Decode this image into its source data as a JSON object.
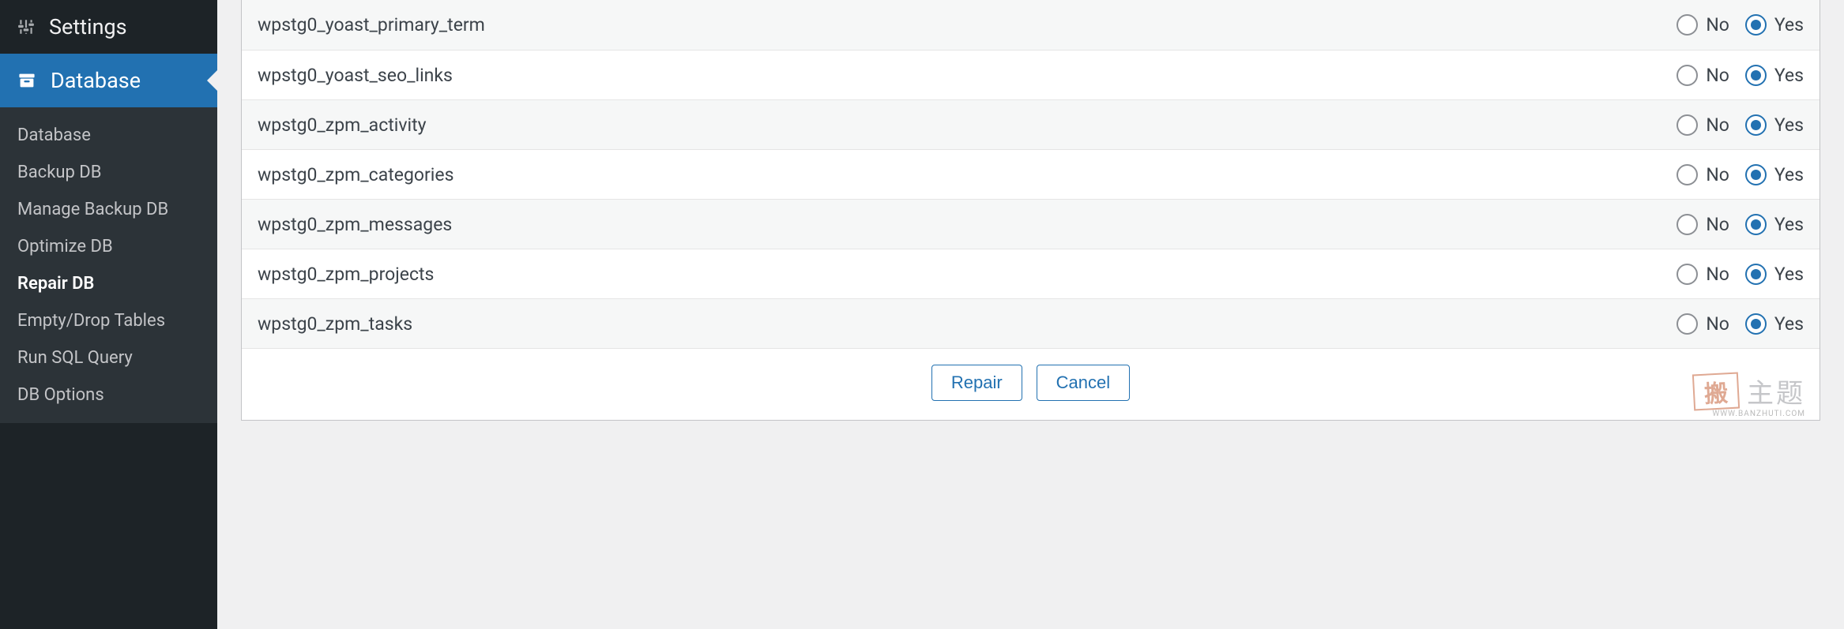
{
  "sidebar": {
    "top": {
      "label": "Settings"
    },
    "active_section": {
      "label": "Database"
    },
    "items": [
      {
        "label": "Database",
        "current": false
      },
      {
        "label": "Backup DB",
        "current": false
      },
      {
        "label": "Manage Backup DB",
        "current": false
      },
      {
        "label": "Optimize DB",
        "current": false
      },
      {
        "label": "Repair DB",
        "current": true
      },
      {
        "label": "Empty/Drop Tables",
        "current": false
      },
      {
        "label": "Run SQL Query",
        "current": false
      },
      {
        "label": "DB Options",
        "current": false
      }
    ]
  },
  "labels": {
    "no": "No",
    "yes": "Yes"
  },
  "tables": [
    {
      "name": "wpstg0_yoast_primary_term",
      "selected": "yes"
    },
    {
      "name": "wpstg0_yoast_seo_links",
      "selected": "yes"
    },
    {
      "name": "wpstg0_zpm_activity",
      "selected": "yes"
    },
    {
      "name": "wpstg0_zpm_categories",
      "selected": "yes"
    },
    {
      "name": "wpstg0_zpm_messages",
      "selected": "yes"
    },
    {
      "name": "wpstg0_zpm_projects",
      "selected": "yes"
    },
    {
      "name": "wpstg0_zpm_tasks",
      "selected": "yes"
    }
  ],
  "buttons": {
    "repair": "Repair",
    "cancel": "Cancel"
  },
  "watermark": {
    "stamp": "搬",
    "text": "主题",
    "sub": "WWW.BANZHUTI.COM"
  }
}
